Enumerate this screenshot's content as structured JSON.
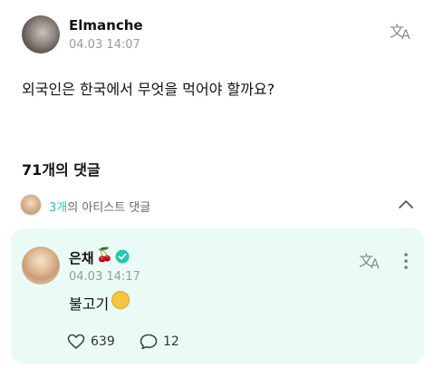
{
  "post": {
    "author": "Elmanche",
    "date": "04.03 14:07",
    "body": "외국인은 한국에서 무엇을 먹어야 할까요?"
  },
  "comments": {
    "title": "71개의 댓글",
    "artist_count": "3개",
    "artist_label": "의 아티스트 댓글"
  },
  "artist_comment": {
    "name": "은채",
    "name_emoji": "🍒",
    "date": "04.03 14:17",
    "text": "불고기",
    "likes": "639",
    "replies": "12"
  },
  "colors": {
    "accent": "#26c7b0",
    "card_bg": "#eafaf7",
    "muted": "#9a9a9a"
  },
  "icons": [
    "translate-icon",
    "chevron-up-icon",
    "verified-badge-icon",
    "more-vertical-icon",
    "like-icon",
    "comment-icon",
    "cherry-icon",
    "shushing-face-emoji"
  ]
}
